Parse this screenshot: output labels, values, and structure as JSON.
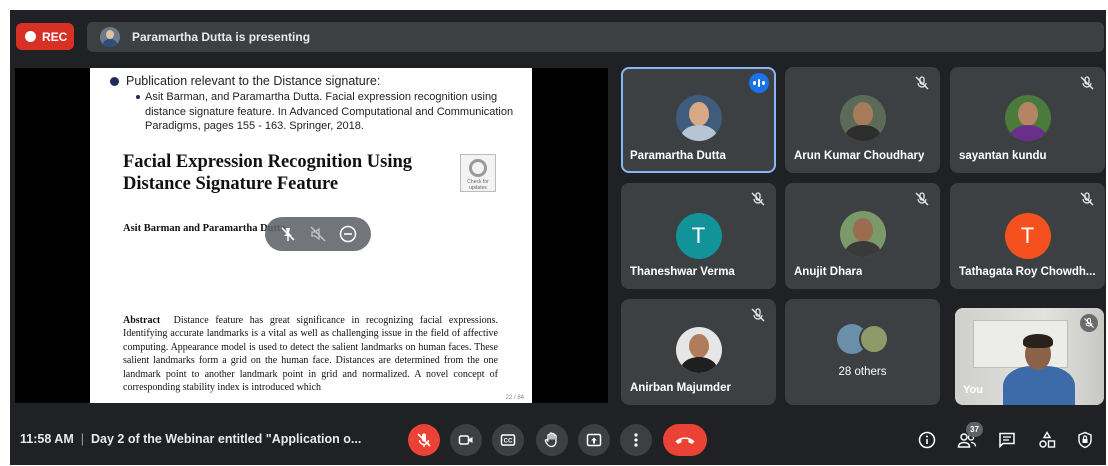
{
  "topbar": {
    "rec_label": "REC",
    "presenting_text": "Paramartha Dutta is presenting"
  },
  "slide": {
    "bullet_heading": "Publication relevant to the Distance signature:",
    "reference": "Asit Barman, and Paramartha Dutta. Facial expression recognition using distance signature feature. In Advanced Computational and Communication Paradigms, pages 155 - 163. Springer, 2018.",
    "paper_title": "Facial Expression Recognition Using Distance Signature Feature",
    "check_badge": "Check for updates",
    "authors": "Asit Barman and Paramartha Dutta",
    "abstract_label": "Abstract",
    "abstract_text": "Distance feature has great significance in recognizing facial expressions. Identifying accurate landmarks is a vital as well as challenging issue in the field of affective computing. Appearance model is used to detect the salient landmarks on human faces. These salient landmarks form a grid on the human face. Distances are determined from the one landmark point to another landmark point in grid and normalized. A novel concept of corresponding stability index is introduced which",
    "page_number": "22 / 84"
  },
  "participants": [
    {
      "name": "Paramartha Dutta",
      "speaking": true
    },
    {
      "name": "Arun Kumar Choudhary",
      "muted": true
    },
    {
      "name": "sayantan kundu",
      "muted": true
    },
    {
      "name": "Thaneshwar Verma",
      "muted": true,
      "initial": "T",
      "color": "#12939a"
    },
    {
      "name": "Anujit Dhara",
      "muted": true
    },
    {
      "name": "Tathagata Roy Chowdh...",
      "muted": true,
      "initial": "T",
      "color": "#f4511e"
    },
    {
      "name": "Anirban Majumder",
      "muted": true
    }
  ],
  "others_label": "28 others",
  "self_label": "You",
  "bottom": {
    "time": "11:58 AM",
    "meeting_title": "Day 2 of the Webinar entitled \"Application o...",
    "participant_count": "37"
  },
  "colors": {
    "accent": "#1a73e8",
    "danger": "#ea4335",
    "surface": "#3c4043",
    "background": "#202124"
  }
}
